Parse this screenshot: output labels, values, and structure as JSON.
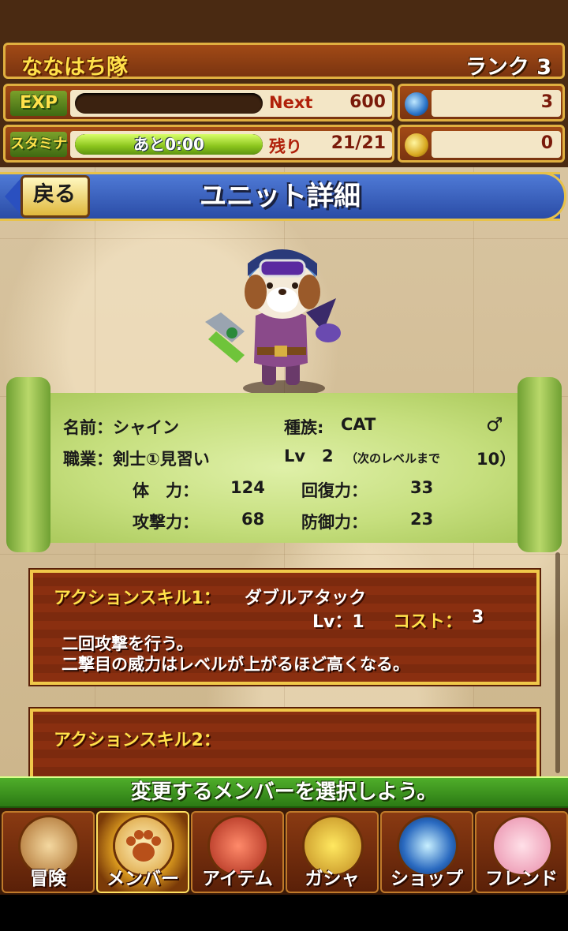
{
  "header": {
    "team_name": "ななはち隊",
    "rank": "ランク 3",
    "exp": {
      "label": "EXP",
      "key": "Next",
      "value": "600",
      "progress": 0.0
    },
    "stamina": {
      "label": "スタミナ",
      "bar_text": "あと0:00",
      "key": "残り",
      "value": "21/21",
      "progress": 1.0
    },
    "currencies": [
      {
        "icon": "blue-orb-icon",
        "value": "3"
      },
      {
        "icon": "gold-coin-icon",
        "value": "0"
      }
    ]
  },
  "title_bar": {
    "back_label": "戻る",
    "title": "ユニット詳細"
  },
  "unit": {
    "name_label": "名前：シャイン",
    "race_label": "種族:",
    "race": "CAT",
    "gender": "♂",
    "job_label": "職業：剣士①見習い",
    "lv_label": "Lv",
    "lv": "2",
    "next_label": "（次のレベルまで",
    "next_value": "10）",
    "stats": [
      {
        "label": "体　力：",
        "value": "124"
      },
      {
        "label": "回復力：",
        "value": "33"
      },
      {
        "label": "攻撃力：",
        "value": "68"
      },
      {
        "label": "防御力：",
        "value": "23"
      }
    ]
  },
  "skills": [
    {
      "title": "アクションスキル1：",
      "name": "ダブルアタック",
      "lv_text": "Lv：1",
      "cost_label": "コスト：",
      "cost_value": "3",
      "desc": [
        "二回攻撃を行う。",
        "二撃目の威力はレベルが上がるほど高くなる。"
      ]
    },
    {
      "title": "アクションスキル2："
    }
  ],
  "instruction": "変更するメンバーを選択しよう。",
  "nav": [
    {
      "label": "冒険",
      "icon": "adventure-bag-icon",
      "active": false
    },
    {
      "label": "メンバー",
      "icon": "paw-icon",
      "active": true
    },
    {
      "label": "アイテム",
      "icon": "treasure-chest-icon",
      "active": false
    },
    {
      "label": "ガシャ",
      "icon": "gacha-capsule-icon",
      "active": false
    },
    {
      "label": "ショップ",
      "icon": "crystal-orb-icon",
      "active": false
    },
    {
      "label": "フレンド",
      "icon": "friends-icon",
      "active": false
    }
  ],
  "colors": {
    "accent": "#e8c24a",
    "title_blue": "#2a4ca6",
    "panel_red": "#8a2f10",
    "nav_green": "#2c7a14"
  }
}
